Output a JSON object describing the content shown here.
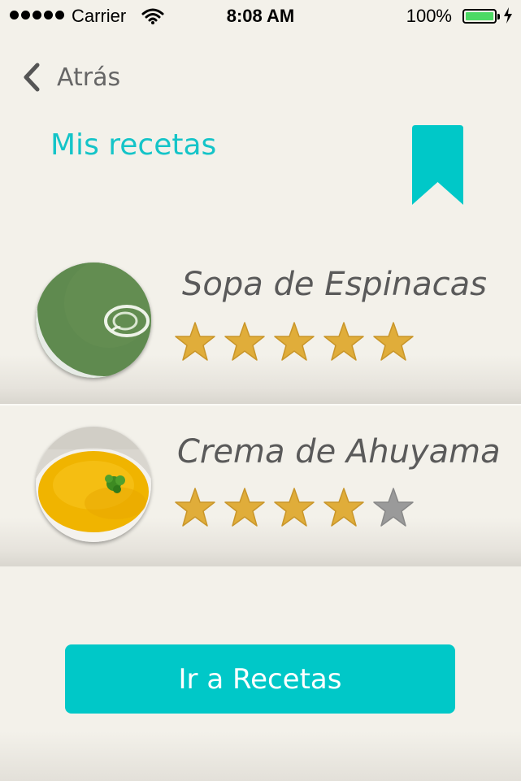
{
  "status_bar": {
    "carrier": "Carrier",
    "time": "8:08 AM",
    "battery": "100%",
    "icons": [
      "signal-dots-icon",
      "wifi-icon",
      "battery-icon",
      "charging-bolt-icon"
    ]
  },
  "nav": {
    "back_label": "Atrás",
    "back_icon": "chevron-left-icon"
  },
  "header": {
    "title": "Mis recetas",
    "bookmark_icon": "bookmark-icon"
  },
  "recipes": [
    {
      "name": "Sopa de Espinacas",
      "rating": 5,
      "max_rating": 5,
      "image": "spinach-soup-photo"
    },
    {
      "name": "Crema de Ahuyama",
      "rating": 4,
      "max_rating": 5,
      "image": "pumpkin-cream-photo"
    }
  ],
  "cta": {
    "label": "Ir a Recetas"
  },
  "colors": {
    "accent": "#00c8c8",
    "star_active": "#e0ad3a",
    "star_inactive": "#999999",
    "background": "#f3f1ea"
  }
}
